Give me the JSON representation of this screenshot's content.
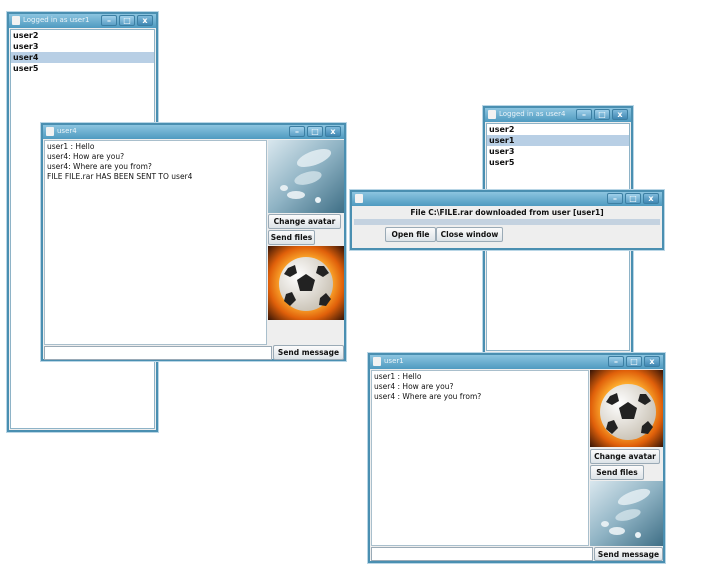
{
  "login_window_1": {
    "title": "Logged in as user1",
    "users": [
      "user2",
      "user3",
      "user4",
      "user5"
    ],
    "selected_index": 2
  },
  "chat_window_1": {
    "title": "user4",
    "messages": [
      "user1 : Hello",
      "user4: How are you?",
      "user4: Where are you from?",
      "FILE FILE.rar HAS BEEN SENT TO user4"
    ],
    "change_avatar_label": "Change avatar",
    "send_files_label": "Send files",
    "send_message_label": "Send message"
  },
  "login_window_2": {
    "title": "Logged in as user4",
    "users": [
      "user2",
      "user1",
      "user3",
      "user5"
    ],
    "selected_index": 1
  },
  "download_dialog": {
    "message": "File C:\\FILE.rar downloaded from user [user1]",
    "open_file_label": "Open file",
    "close_window_label": "Close window"
  },
  "chat_window_2": {
    "title": "user1",
    "messages": [
      "user1 : Hello",
      "user4 : How are you?",
      "user4 : Where are you from?"
    ],
    "change_avatar_label": "Change avatar",
    "send_files_label": "Send files",
    "send_message_label": "Send message"
  },
  "colors": {
    "title_bar": "#4f9ac0",
    "window_border": "#4a8fb1",
    "selection": "#b8cfe5"
  },
  "icons": [
    "java-cup-icon",
    "minimize-icon",
    "maximize-icon",
    "close-icon",
    "water-drops-avatar",
    "soccer-ball-avatar"
  ]
}
